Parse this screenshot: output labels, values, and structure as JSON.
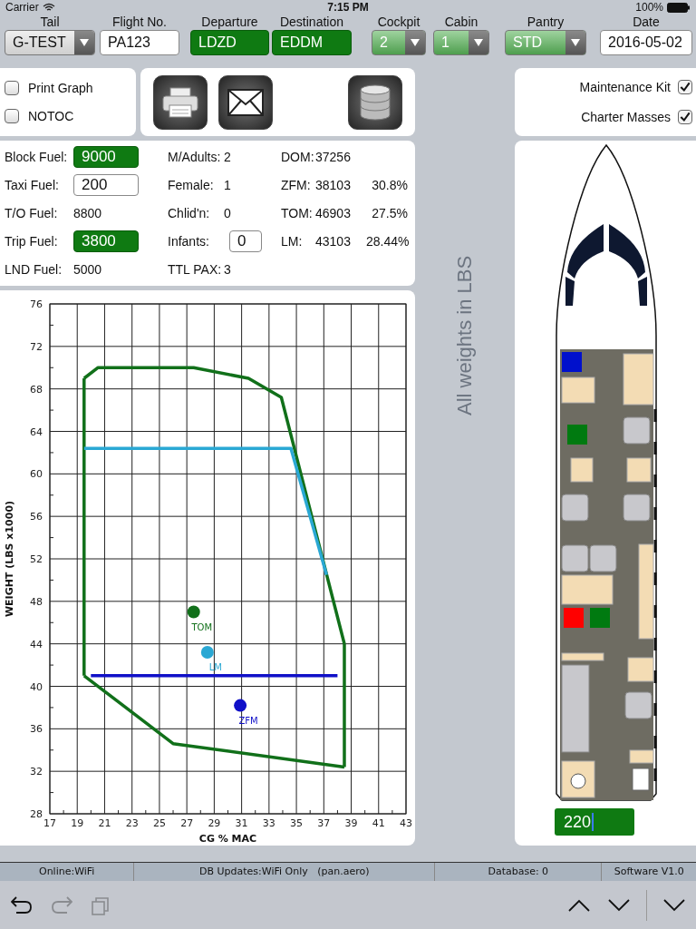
{
  "status_top": {
    "carrier": "Carrier",
    "time": "7:15 PM",
    "battery": "100%"
  },
  "header": {
    "fields": [
      {
        "label": "Tail",
        "value": "G-TEST",
        "kind": "select",
        "highlight": false
      },
      {
        "label": "Flight No.",
        "value": "PA123",
        "kind": "text",
        "highlight": false
      },
      {
        "label": "Departure",
        "value": "LDZD",
        "kind": "text",
        "highlight": true
      },
      {
        "label": "Destination",
        "value": "EDDM",
        "kind": "text",
        "highlight": true
      },
      {
        "label": "Cockpit",
        "value": "2",
        "kind": "select",
        "highlight": true
      },
      {
        "label": "Cabin",
        "value": "1",
        "kind": "select",
        "highlight": true
      },
      {
        "label": "Pantry",
        "value": "STD",
        "kind": "select",
        "highlight": true
      },
      {
        "label": "Date",
        "value": "2016-05-02",
        "kind": "text",
        "highlight": false
      }
    ]
  },
  "options": [
    {
      "label": "Print Graph",
      "checked": false
    },
    {
      "label": "NOTOC",
      "checked": false
    }
  ],
  "settings": [
    {
      "label": "Maintenance Kit",
      "checked": true
    },
    {
      "label": "Charter Masses",
      "checked": true
    }
  ],
  "fuel": [
    {
      "label": "Block Fuel:",
      "value": "9000",
      "kind": "field",
      "highlight": true
    },
    {
      "label": "Taxi Fuel:",
      "value": "200",
      "kind": "field",
      "highlight": false
    },
    {
      "label": "T/O Fuel:",
      "value": "8800",
      "kind": "text",
      "highlight": false
    },
    {
      "label": "Trip Fuel:",
      "value": "3800",
      "kind": "field",
      "highlight": true
    },
    {
      "label": "LND Fuel:",
      "value": "5000",
      "kind": "text",
      "highlight": false
    }
  ],
  "passengers": [
    {
      "label": "M/Adults:",
      "value": "2",
      "kind": "text"
    },
    {
      "label": "Female:",
      "value": "1",
      "kind": "text"
    },
    {
      "label": "Chlid'n:",
      "value": "0",
      "kind": "text"
    },
    {
      "label": "Infants:",
      "value": "0",
      "kind": "field"
    },
    {
      "label": "TTL PAX:",
      "value": "3",
      "kind": "text"
    }
  ],
  "masses": [
    {
      "label": "DOM:",
      "value": "37256"
    },
    {
      "label": "ZFM:",
      "value": "38103",
      "percent": "30.8%"
    },
    {
      "label": "TOM:",
      "value": "46903",
      "percent": "27.5%"
    },
    {
      "label": "LM:",
      "value": "43103",
      "percent": "28.44%"
    }
  ],
  "graph": {
    "chart_data": {
      "type": "line",
      "xlabel": "CG % MAC",
      "ylabel": "WEIGHT (LBS x1000)",
      "xlim": [
        17,
        43
      ],
      "ylim": [
        28,
        76
      ],
      "grid": true,
      "xticks": [
        17,
        19,
        21,
        23,
        25,
        27,
        29,
        31,
        33,
        35,
        37,
        39,
        41,
        43
      ],
      "yticks": [
        28,
        32,
        36,
        40,
        44,
        48,
        52,
        56,
        60,
        64,
        68,
        72,
        76
      ],
      "series": [
        {
          "color": "#11701a",
          "x": [
            19.5,
            20.5,
            27.5,
            31.5,
            33.9,
            38.5
          ],
          "values": [
            69,
            70,
            70,
            69,
            67.2,
            44
          ]
        },
        {
          "color": "#11701a",
          "x": [
            19.5,
            26,
            38.5
          ],
          "values": [
            41,
            34.6,
            32.4
          ]
        },
        {
          "color": "#2aa8d4",
          "x": [
            19.5,
            34.6,
            37.2
          ],
          "values": [
            62.4,
            62.4,
            50.5
          ]
        },
        {
          "color": "#1010c8",
          "x": [
            20,
            38
          ],
          "values": [
            41,
            41
          ]
        },
        {
          "name": "TOM",
          "color": "#11701a",
          "x": [
            27.5
          ],
          "values": [
            47
          ],
          "marker": true
        },
        {
          "name": "LM",
          "color": "#2aa8d4",
          "x": [
            28.5
          ],
          "values": [
            43.2
          ],
          "marker": true
        },
        {
          "name": "ZFM",
          "color": "#1010c8",
          "x": [
            30.9
          ],
          "values": [
            38.2
          ],
          "marker": true
        }
      ]
    }
  },
  "units_note": "All weights in LBS",
  "cabin": {
    "occupied_seats": [
      {
        "color": "#0010cc"
      },
      {
        "color": "#007a10"
      },
      {
        "color": "#ff0000"
      },
      {
        "color": "#007a10"
      }
    ],
    "input": "220"
  },
  "status_bar": [
    "Online:WiFi",
    "DB Updates:WiFi Only   (pan.aero)",
    "Database: 0",
    "Software V1.0"
  ],
  "toolbar": [
    {
      "kind": "undo",
      "disabled": false
    },
    {
      "kind": "redo",
      "disabled": true
    },
    {
      "kind": "copy",
      "disabled": true
    },
    {
      "kind": "up",
      "disabled": false
    },
    {
      "kind": "down",
      "disabled": false
    },
    {
      "kind": "collapse",
      "disabled": false
    }
  ]
}
